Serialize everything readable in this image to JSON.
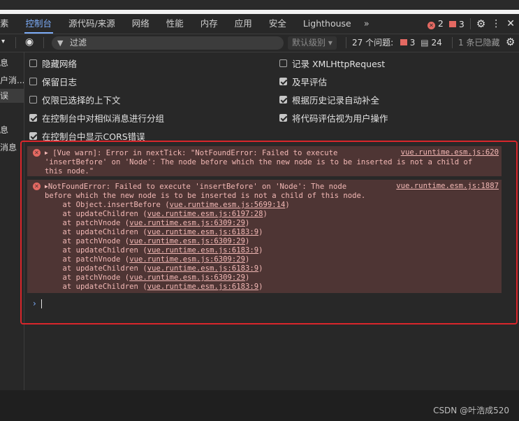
{
  "tabs": {
    "items": [
      "素",
      "控制台",
      "源代码/来源",
      "网络",
      "性能",
      "内存",
      "应用",
      "安全",
      "Lighthouse"
    ],
    "active_index": 1,
    "more": "»",
    "error_count": "2",
    "warning_count": "3"
  },
  "filter": {
    "placeholder": "过滤",
    "levels": "默认级别 ▾",
    "issues_label": "27 个问题:",
    "issues_errors": "3",
    "issues_info": "24",
    "hidden": "1 条已隐藏"
  },
  "sidebar": {
    "items": [
      "息",
      "户消...",
      "误",
      "息",
      "消息"
    ]
  },
  "settings": {
    "left": [
      {
        "label": "隐藏网络",
        "checked": false
      },
      {
        "label": "保留日志",
        "checked": false
      },
      {
        "label": "仅限已选择的上下文",
        "checked": false
      },
      {
        "label": "在控制台中对相似消息进行分组",
        "checked": true
      },
      {
        "label": "在控制台中显示CORS错误",
        "checked": true
      }
    ],
    "right": [
      {
        "label": "记录 XMLHttpRequest",
        "checked": false
      },
      {
        "label": "及早评估",
        "checked": true
      },
      {
        "label": "根据历史记录自动补全",
        "checked": true
      },
      {
        "label": "将代码评估视为用户操作",
        "checked": true
      }
    ]
  },
  "messages": {
    "m1": {
      "text": "[Vue warn]: Error in nextTick: \"NotFoundError: Failed to execute\n'insertBefore' on 'Node': The node before which the new node is to be inserted is not a child of\nthis node.\"",
      "source": "vue.runtime.esm.js:620"
    },
    "m2": {
      "head": "NotFoundError: Failed to execute 'insertBefore' on 'Node': The node\nbefore which the new node is to be inserted is not a child of this node.",
      "source": "vue.runtime.esm.js:1887",
      "stack": [
        {
          "fn": "    at Object.insertBefore (",
          "loc": "vue.runtime.esm.js:5699:14",
          "end": ")"
        },
        {
          "fn": "    at updateChildren (",
          "loc": "vue.runtime.esm.js:6197:28",
          "end": ")"
        },
        {
          "fn": "    at patchVnode (",
          "loc": "vue.runtime.esm.js:6309:29",
          "end": ")"
        },
        {
          "fn": "    at updateChildren (",
          "loc": "vue.runtime.esm.js:6183:9",
          "end": ")"
        },
        {
          "fn": "    at patchVnode (",
          "loc": "vue.runtime.esm.js:6309:29",
          "end": ")"
        },
        {
          "fn": "    at updateChildren (",
          "loc": "vue.runtime.esm.js:6183:9",
          "end": ")"
        },
        {
          "fn": "    at patchVnode (",
          "loc": "vue.runtime.esm.js:6309:29",
          "end": ")"
        },
        {
          "fn": "    at updateChildren (",
          "loc": "vue.runtime.esm.js:6183:9",
          "end": ")"
        },
        {
          "fn": "    at patchVnode (",
          "loc": "vue.runtime.esm.js:6309:29",
          "end": ")"
        },
        {
          "fn": "    at updateChildren (",
          "loc": "vue.runtime.esm.js:6183:9",
          "end": ")"
        }
      ]
    }
  },
  "prompt": "›",
  "watermark": "CSDN @叶浩成520"
}
